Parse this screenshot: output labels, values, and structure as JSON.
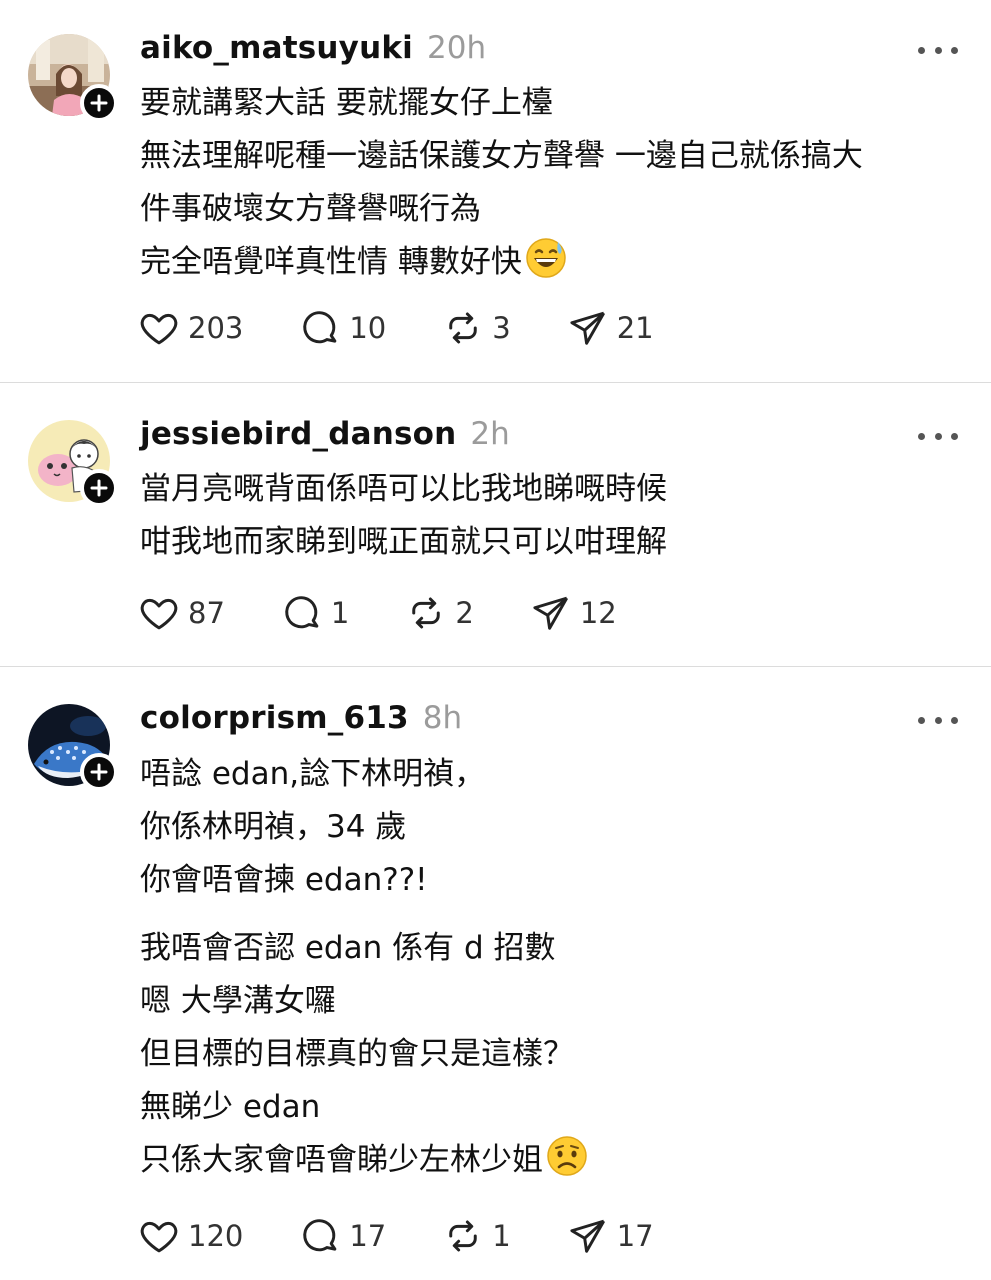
{
  "posts": [
    {
      "username": "aiko_matsuyuki",
      "time": "20h",
      "avatar": "photo-avatar",
      "lines": [
        "要就講緊大話 要就擺女仔上檯",
        "無法理解呢種一邊話保護女方聲譽 一邊自己就係搞大",
        "件事破壞女方聲譽嘅行為",
        "完全唔覺咩真性情 轉數好快"
      ],
      "trailing_emoji": "grinning-sweat-emoji",
      "likes": "203",
      "replies": "10",
      "reposts": "3",
      "shares": "21"
    },
    {
      "username": "jessiebird_danson",
      "time": "2h",
      "avatar": "cartoon-avatar",
      "lines": [
        "當月亮嘅背面係唔可以比我地睇嘅時候",
        "咁我地而家睇到嘅正面就只可以咁理解"
      ],
      "likes": "87",
      "replies": "1",
      "reposts": "2",
      "shares": "12"
    },
    {
      "username": "colorprism_613",
      "time": "8h",
      "avatar": "whale-shark-avatar",
      "lines_a": [
        "唔諗 edan,諗下林明禎，",
        "你係林明禎，34 歲",
        "你會唔會揀 edan??!"
      ],
      "lines_b": [
        "我唔會否認 edan 係有 d 招數",
        "嗯 大學溝女囉",
        "但目標的目標真的會只是這樣？",
        "無睇少 edan",
        "只係大家會唔會睇少左林少姐"
      ],
      "trailing_emoji": "worried-face-emoji",
      "likes": "120",
      "replies": "17",
      "reposts": "1",
      "shares": "17"
    }
  ],
  "colors": {
    "text": "#111111",
    "muted": "#9b9b9b",
    "divider": "#dcdcdc",
    "badge": "#0a0a0a"
  }
}
